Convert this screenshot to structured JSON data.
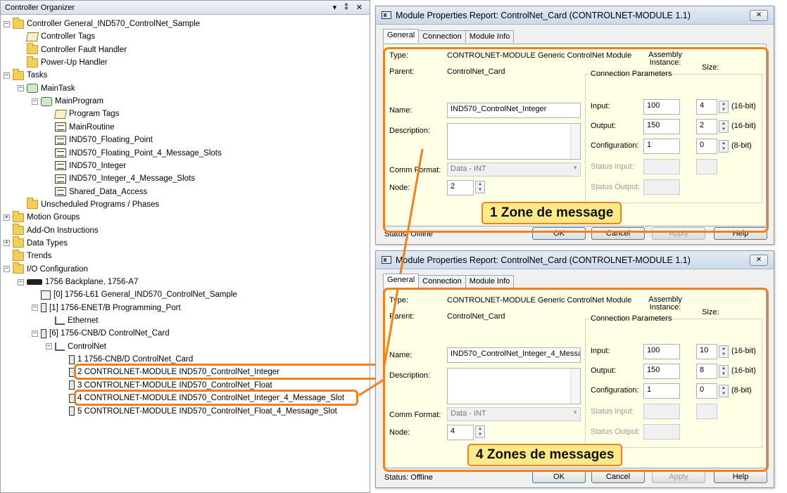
{
  "organizer": {
    "title": "Controller Organizer",
    "window_controls": "▾ ⁑ ✕",
    "tree": [
      {
        "label": "Controller General_IND570_ControlNet_Sample",
        "icon": "folder-icon",
        "expander": "−"
      },
      {
        "label": "Controller Tags",
        "icon": "tags-icon",
        "expander": ""
      },
      {
        "label": "Controller Fault Handler",
        "icon": "folder-icon",
        "expander": ""
      },
      {
        "label": "Power-Up Handler",
        "icon": "folder-icon",
        "expander": ""
      },
      {
        "label": "Tasks",
        "icon": "folder-icon",
        "expander": "−"
      },
      {
        "label": "MainTask",
        "icon": "task-icon",
        "expander": "−"
      },
      {
        "label": "MainProgram",
        "icon": "program-folder-icon",
        "expander": "−"
      },
      {
        "label": "Program Tags",
        "icon": "tags-icon",
        "expander": ""
      },
      {
        "label": "MainRoutine",
        "icon": "routine-icon",
        "expander": ""
      },
      {
        "label": "IND570_Floating_Point",
        "icon": "routine-icon",
        "expander": ""
      },
      {
        "label": "IND570_Floating_Point_4_Message_Slots",
        "icon": "routine-icon",
        "expander": ""
      },
      {
        "label": "IND570_Integer",
        "icon": "routine-icon",
        "expander": ""
      },
      {
        "label": "IND570_Integer_4_Message_Slots",
        "icon": "routine-icon",
        "expander": ""
      },
      {
        "label": "Shared_Data_Access",
        "icon": "routine-icon",
        "expander": ""
      },
      {
        "label": "Unscheduled Programs / Phases",
        "icon": "folder-icon",
        "expander": ""
      },
      {
        "label": "Motion Groups",
        "icon": "folder-icon",
        "expander": "+"
      },
      {
        "label": "Add-On Instructions",
        "icon": "folder-icon",
        "expander": ""
      },
      {
        "label": "Data Types",
        "icon": "folder-icon",
        "expander": "+"
      },
      {
        "label": "Trends",
        "icon": "folder-icon",
        "expander": ""
      },
      {
        "label": "I/O Configuration",
        "icon": "folder-icon",
        "expander": "−"
      },
      {
        "label": "1756 Backplane, 1756-A7",
        "icon": "backplane-icon",
        "expander": "−"
      },
      {
        "label": "[0] 1756-L61 General_IND570_ControlNet_Sample",
        "icon": "controller-icon",
        "expander": ""
      },
      {
        "label": "[1] 1756-ENET/B Programming_Port",
        "icon": "card-icon",
        "expander": "−"
      },
      {
        "label": "Ethernet",
        "icon": "network-icon",
        "expander": ""
      },
      {
        "label": "[6] 1756-CNB/D ControlNet_Card",
        "icon": "card-icon",
        "expander": "−"
      },
      {
        "label": "ControlNet",
        "icon": "network-icon",
        "expander": "−"
      },
      {
        "label": "1 1756-CNB/D ControlNet_Card",
        "icon": "card-icon",
        "expander": ""
      },
      {
        "label": "2 CONTROLNET-MODULE IND570_ControlNet_Integer",
        "icon": "module-icon",
        "expander": ""
      },
      {
        "label": "3 CONTROLNET-MODULE IND570_ControlNet_Float",
        "icon": "module-icon",
        "expander": ""
      },
      {
        "label": "4 CONTROLNET-MODULE IND570_ControlNet_Integer_4_Message_Slot",
        "icon": "module-icon",
        "expander": ""
      },
      {
        "label": "5 CONTROLNET-MODULE IND570_ControlNet_Float_4_Message_Slot",
        "icon": "module-icon",
        "expander": ""
      }
    ]
  },
  "dialogs": [
    {
      "title": "Module Properties Report: ControlNet_Card (CONTROLNET-MODULE 1.1)",
      "close": "✕",
      "tabs": [
        "General",
        "Connection",
        "Module Info"
      ],
      "type_label": "Type:",
      "type_value": "CONTROLNET-MODULE Generic ControlNet Module",
      "parent_label": "Parent:",
      "parent_value": "ControlNet_Card",
      "name_label": "Name:",
      "name_value": "IND570_ControlNet_Integer",
      "description_label": "Description:",
      "comm_format_label": "Comm Format:",
      "comm_format_value": "Data - INT",
      "node_label": "Node:",
      "node_value": "2",
      "conn_params_label": "Connection Parameters",
      "assembly_label": "Assembly Instance:",
      "size_label": "Size:",
      "input_label": "Input:",
      "input_instance": "100",
      "input_size": "4",
      "input_unit": "(16-bit)",
      "output_label": "Output:",
      "output_instance": "150",
      "output_size": "2",
      "output_unit": "(16-bit)",
      "config_label": "Configuration:",
      "config_instance": "1",
      "config_size": "0",
      "config_unit": "(8-bit)",
      "status_input_label": "Status Input:",
      "status_output_label": "Status Output:",
      "status_text": "Status: Offline",
      "ok_label": "OK",
      "cancel_label": "Cancel",
      "apply_label": "Apply",
      "help_label": "Help",
      "callout": "1 Zone de message"
    },
    {
      "title": "Module Properties Report: ControlNet_Card (CONTROLNET-MODULE 1.1)",
      "close": "✕",
      "tabs": [
        "General",
        "Connection",
        "Module Info"
      ],
      "type_label": "Type:",
      "type_value": "CONTROLNET-MODULE Generic ControlNet Module",
      "parent_label": "Parent:",
      "parent_value": "ControlNet_Card",
      "name_label": "Name:",
      "name_value": "IND570_ControlNet_Integer_4_Messa",
      "description_label": "Description:",
      "comm_format_label": "Comm Format:",
      "comm_format_value": "Data - INT",
      "node_label": "Node:",
      "node_value": "4",
      "conn_params_label": "Connection Parameters",
      "assembly_label": "Assembly Instance:",
      "size_label": "Size:",
      "input_label": "Input:",
      "input_instance": "100",
      "input_size": "10",
      "input_unit": "(16-bit)",
      "output_label": "Output:",
      "output_instance": "150",
      "output_size": "8",
      "output_unit": "(16-bit)",
      "config_label": "Configuration:",
      "config_instance": "1",
      "config_size": "0",
      "config_unit": "(8-bit)",
      "status_input_label": "Status Input:",
      "status_output_label": "Status Output:",
      "status_text": "Status: Offline",
      "ok_label": "OK",
      "cancel_label": "Cancel",
      "apply_label": "Apply",
      "help_label": "Help",
      "callout": "4 Zones de messages"
    }
  ],
  "colors": {
    "highlight": "#f0801e",
    "callout_fill": "#fde88a",
    "panel_fill": "#ffffe6"
  }
}
